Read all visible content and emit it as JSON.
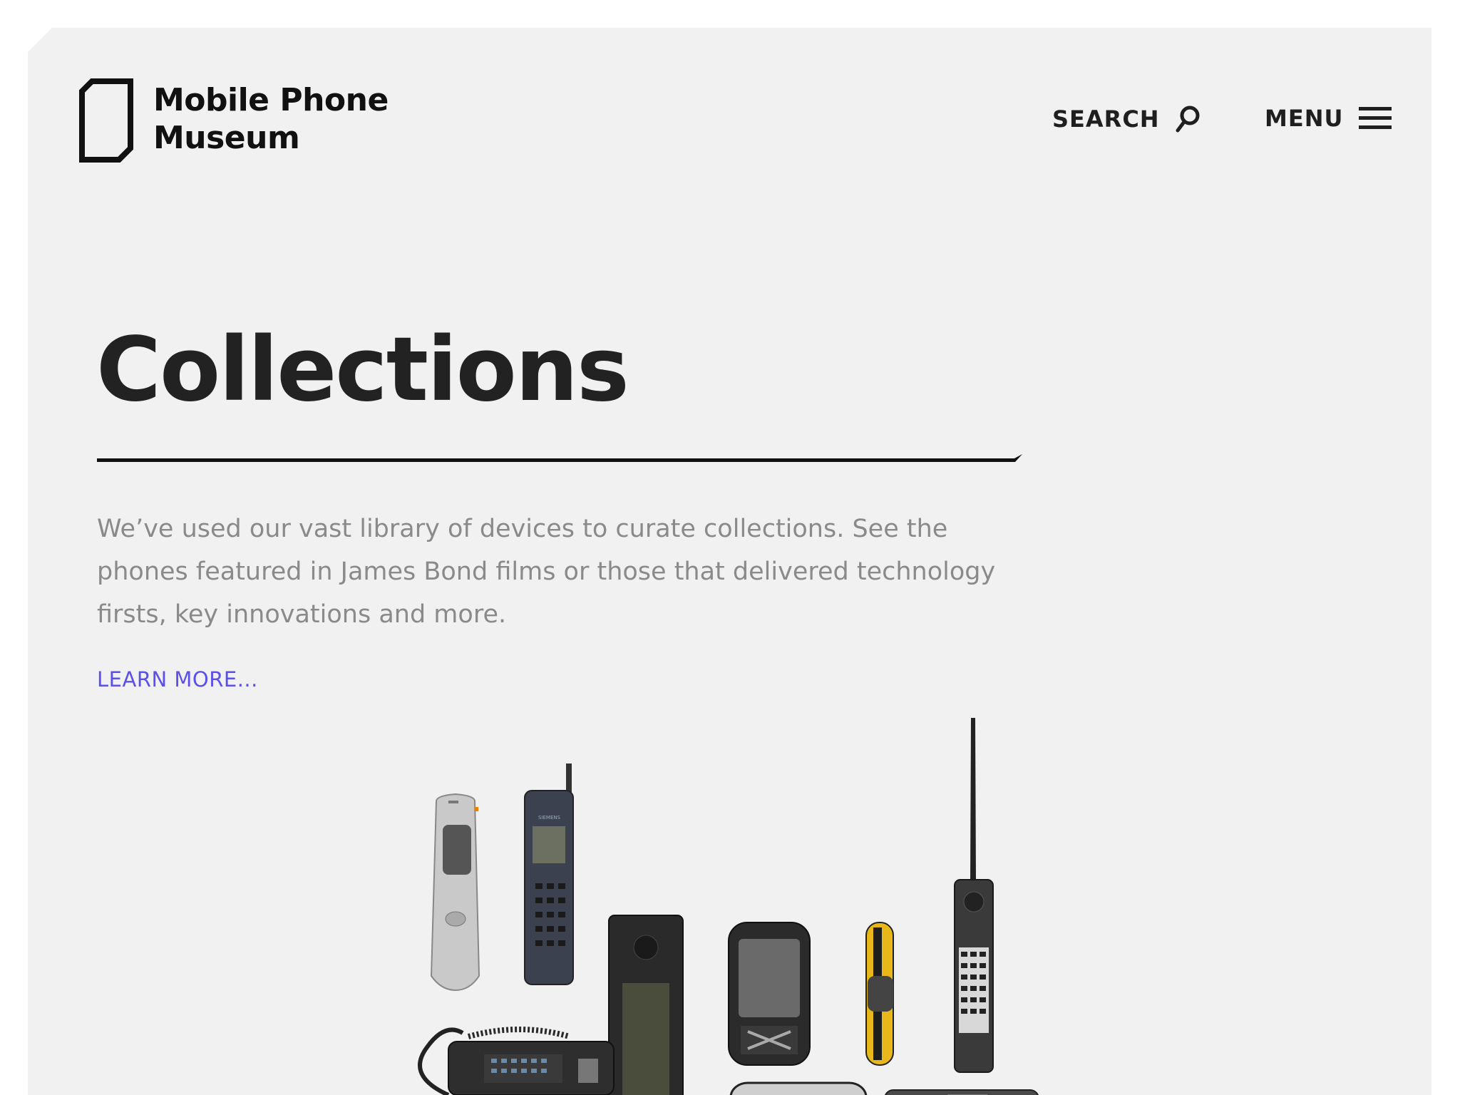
{
  "header": {
    "logo_line1": "Mobile Phone",
    "logo_line2": "Museum",
    "search_label": "SEARCH",
    "menu_label": "MENU"
  },
  "hero": {
    "title": "Collections",
    "intro": "We’ve used our vast library of devices to curate collections. See the phones featured in James Bond films or those that delivered technology firsts, key innovations and more.",
    "learn_more": "LEARN MORE..."
  },
  "phones": [
    {
      "name": "silver-flip-phone",
      "brand": ""
    },
    {
      "name": "siemens-phone",
      "brand": "SIEMENS"
    },
    {
      "name": "ibm-simon-phone",
      "brand": ""
    },
    {
      "name": "pda-phone",
      "brand": ""
    },
    {
      "name": "yellow-bracelet-phone",
      "brand": ""
    },
    {
      "name": "motorola-brick-phone",
      "brand": ""
    },
    {
      "name": "car-phone",
      "brand": ""
    },
    {
      "name": "iphone",
      "brand": ""
    },
    {
      "name": "keypad-phone",
      "brand": ""
    }
  ],
  "colors": {
    "page_bg": "#ffffff",
    "panel_bg": "#f1f1f1",
    "title": "#222222",
    "body_text": "#8a8a8a",
    "link": "#5b50ea"
  }
}
